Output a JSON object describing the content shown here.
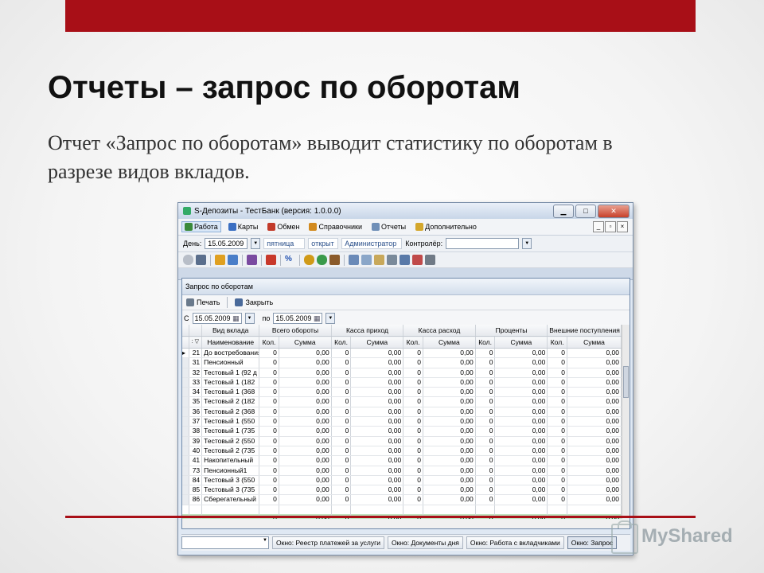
{
  "slide": {
    "title": "Отчеты – запрос по оборотам",
    "text": "Отчет «Запрос по оборотам» выводит статистику по оборотам в разрезе видов вкладов."
  },
  "colors": {
    "accent": "#a80f17",
    "total_row": "#bfe3bf"
  },
  "watermark": {
    "text": "MyShared"
  },
  "app": {
    "title": "S-Депозиты - ТестБанк (версия: 1.0.0.0)",
    "menu": [
      {
        "label": "Работа",
        "icon": "work-icon",
        "color": "#3a8a3a"
      },
      {
        "label": "Карты",
        "icon": "cards-icon",
        "color": "#3b6fc2"
      },
      {
        "label": "Обмен",
        "icon": "exchange-icon",
        "color": "#c23a2a"
      },
      {
        "label": "Справочники",
        "icon": "reference-books-icon",
        "color": "#d28a1e"
      },
      {
        "label": "Отчеты",
        "icon": "reports-icon",
        "color": "#6f8fb8"
      },
      {
        "label": "Дополнительно",
        "icon": "extra-icon",
        "color": "#d4a72c"
      }
    ],
    "filter": {
      "day_label": "День:",
      "day_value": "15.05.2009",
      "weekday": "пятница",
      "status": "открыт",
      "user": "Администратор",
      "controller_label": "Контролёр:"
    },
    "child": {
      "title": "Запрос по оборотам",
      "print_label": "Печать",
      "close_label": "Закрыть",
      "from_label": "С",
      "from_date": "15.05.2009",
      "to_label": "по",
      "to_date": "15.05.2009",
      "group_headers": [
        "Вид вклада",
        "Всего обороты",
        "Касса приход",
        "Касса расход",
        "Проценты",
        "Внешние поступления"
      ],
      "sub_headers": [
        "Наименование",
        "Кол.",
        "Сумма",
        "Кол.",
        "Сумма",
        "Кол.",
        "Сумма",
        "Кол.",
        "Сумма",
        "Кол.",
        "Сумма"
      ],
      "rows": [
        {
          "code": "21",
          "name": "До востребования",
          "q": "0",
          "s": "0,00"
        },
        {
          "code": "31",
          "name": "Пенсионный",
          "q": "0",
          "s": "0,00"
        },
        {
          "code": "32",
          "name": "Тестовый 1 (92 д",
          "q": "0",
          "s": "0,00"
        },
        {
          "code": "33",
          "name": "Тестовый 1 (182",
          "q": "0",
          "s": "0,00"
        },
        {
          "code": "34",
          "name": "Тестовый 1 (368",
          "q": "0",
          "s": "0,00"
        },
        {
          "code": "35",
          "name": "Тестовый 2 (182",
          "q": "0",
          "s": "0,00"
        },
        {
          "code": "36",
          "name": "Тестовый 2 (368",
          "q": "0",
          "s": "0,00"
        },
        {
          "code": "37",
          "name": "Тестовый 1 (550",
          "q": "0",
          "s": "0,00"
        },
        {
          "code": "38",
          "name": "Тестовый 1 (735",
          "q": "0",
          "s": "0,00"
        },
        {
          "code": "39",
          "name": "Тестовый 2 (550",
          "q": "0",
          "s": "0,00"
        },
        {
          "code": "40",
          "name": "Тестовый 2 (735",
          "q": "0",
          "s": "0,00"
        },
        {
          "code": "41",
          "name": "Накопительный",
          "q": "0",
          "s": "0,00"
        },
        {
          "code": "73",
          "name": "Пенсионный1",
          "q": "0",
          "s": "0,00"
        },
        {
          "code": "84",
          "name": "Тестовый 3 (550",
          "q": "0",
          "s": "0,00"
        },
        {
          "code": "85",
          "name": "Тестовый 3 (735",
          "q": "0",
          "s": "0,00"
        },
        {
          "code": "86",
          "name": "Сберегательный",
          "q": "0",
          "s": "0,00"
        }
      ],
      "total": {
        "q": "0",
        "s": "0,00"
      }
    },
    "taskbar": [
      {
        "label": "Окно: Реестр платежей за услуги",
        "active": false
      },
      {
        "label": "Окно: Документы дня",
        "active": false
      },
      {
        "label": "Окно: Работа с вкладчиками",
        "active": false
      },
      {
        "label": "Окно: Запрос",
        "active": true
      }
    ]
  }
}
